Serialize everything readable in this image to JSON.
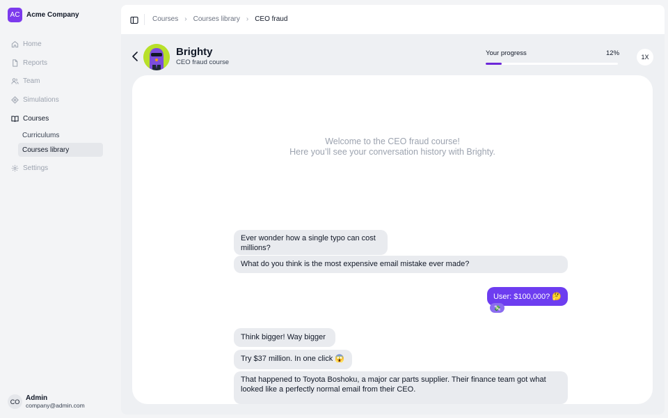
{
  "brand": {
    "logo_initials": "AC",
    "name": "Acme Company",
    "accent": "#7c3aed"
  },
  "nav": {
    "items": [
      {
        "label": "Home",
        "icon": "home-icon"
      },
      {
        "label": "Reports",
        "icon": "document-icon"
      },
      {
        "label": "Team",
        "icon": "users-icon"
      },
      {
        "label": "Simulations",
        "icon": "target-icon"
      },
      {
        "label": "Courses",
        "icon": "book-icon",
        "active": true
      },
      {
        "label": "Settings",
        "icon": "gear-icon"
      }
    ],
    "sub_items": [
      {
        "label": "Curriculums"
      },
      {
        "label": "Courses library",
        "selected": true
      }
    ]
  },
  "user": {
    "initials": "CO",
    "name": "Admin",
    "email": "company@admin.com"
  },
  "breadcrumb": {
    "items": [
      "Courses",
      "Courses library",
      "CEO fraud"
    ]
  },
  "course": {
    "bot_name": "Brighty",
    "subtitle": "CEO fraud course"
  },
  "progress": {
    "label": "Your progress",
    "percent_text": "12%",
    "value": 0.12,
    "color": "#6d28d9"
  },
  "speed": {
    "label": "1X"
  },
  "chat": {
    "welcome_line1": "Welcome to the CEO fraud course!",
    "welcome_line2": "Here you’ll see your conversation history with Brighty.",
    "messages": [
      {
        "from": "bot",
        "text": "Ever wonder how a single typo can cost millions?"
      },
      {
        "from": "bot",
        "text": "What do you think is the most expensive email mistake ever made?"
      },
      {
        "from": "user",
        "text": "User: $100,000? 🤔",
        "reaction": "💸"
      },
      {
        "from": "bot",
        "text": "Think bigger! Way bigger"
      },
      {
        "from": "bot",
        "text": "Try $37 million. In one click 😱"
      },
      {
        "from": "bot",
        "text": "That happened to Toyota Boshoku, a major car parts supplier. Their finance team got what looked like a perfectly normal email from their CEO."
      }
    ],
    "user_bubble_color": "#6d3df0"
  }
}
